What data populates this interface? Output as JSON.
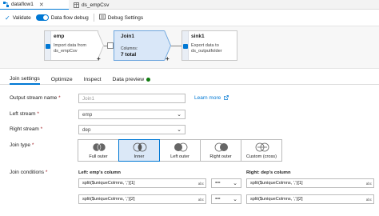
{
  "tabs": [
    {
      "label": "dataflow1"
    },
    {
      "label": "ds_empCsv"
    }
  ],
  "toolbar": {
    "validate_label": "Validate",
    "debug_label": "Data flow debug",
    "debug_settings_label": "Debug Settings"
  },
  "nodes": {
    "emp": {
      "title": "emp",
      "desc": "Import data from ds_empCsv"
    },
    "join": {
      "title": "Join1",
      "columns_label": "Columns:",
      "columns_value": "7 total"
    },
    "sink": {
      "title": "sink1",
      "desc": "Export data to ds_outputfolder"
    }
  },
  "subtabs": {
    "join_settings": "Join settings",
    "optimize": "Optimize",
    "inspect": "Inspect",
    "data_preview": "Data preview"
  },
  "form": {
    "output_label": "Output stream name",
    "output_placeholder": "Join1",
    "learn_more": "Learn more",
    "left_label": "Left stream",
    "left_value": "emp",
    "right_label": "Right stream",
    "right_value": "dep",
    "join_type_label": "Join type",
    "join_types": [
      "Full outer",
      "Inner",
      "Left outer",
      "Right outer",
      "Custom (cross)"
    ],
    "join_conditions_label": "Join conditions",
    "left_col_header": "Left: emp's column",
    "right_col_header": "Right: dep's column",
    "conditions": [
      {
        "left": "split($uniqueColmns, ',')[1]",
        "op": "==",
        "right": "split($uniqueColmns, ',')[1]"
      },
      {
        "left": "split($uniqueColmns, ',')[2]",
        "op": "==",
        "right": "split($uniqueColmns, ',')[2]"
      }
    ],
    "abc_tag": "abc"
  },
  "colors": {
    "accent": "#0078d4",
    "selected_fill": "#d9e7f8",
    "required": "#a4262c"
  }
}
